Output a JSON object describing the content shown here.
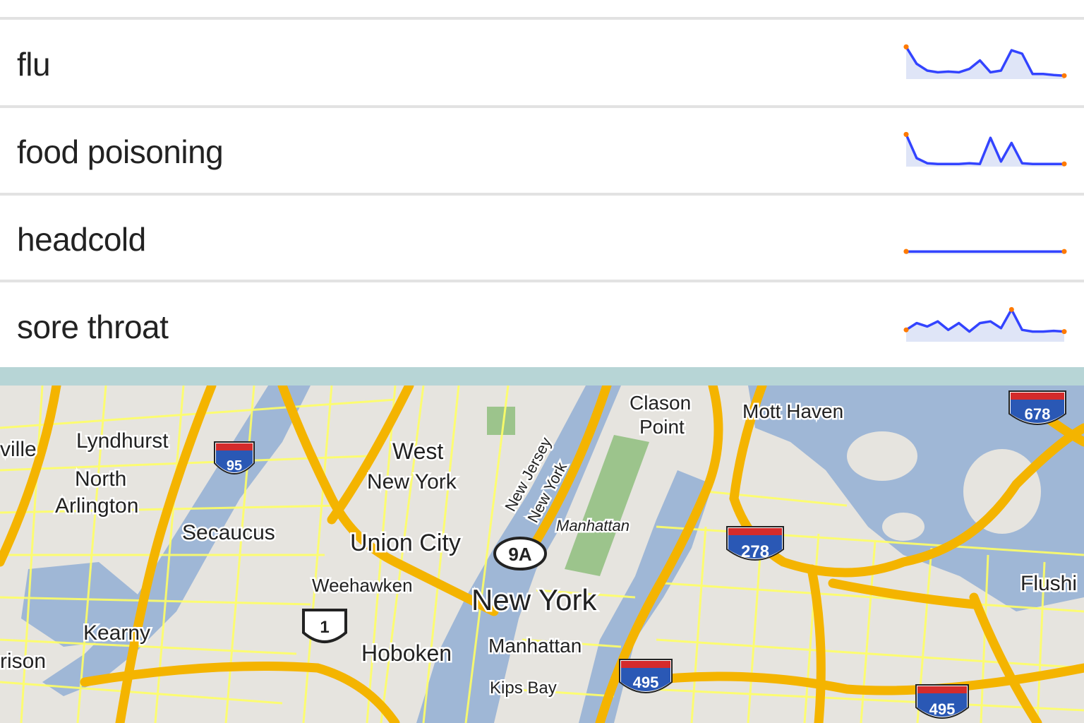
{
  "results": {
    "items": [
      {
        "term": "flu",
        "trend": [
          0.95,
          0.45,
          0.25,
          0.2,
          0.22,
          0.2,
          0.3,
          0.55,
          0.2,
          0.25,
          0.85,
          0.75,
          0.15,
          0.15,
          0.12,
          0.1
        ]
      },
      {
        "term": "food poisoning",
        "trend": [
          0.95,
          0.25,
          0.1,
          0.08,
          0.08,
          0.08,
          0.1,
          0.08,
          0.85,
          0.15,
          0.7,
          0.1,
          0.08,
          0.08,
          0.08,
          0.08
        ]
      },
      {
        "term": "headcold",
        "trend": [
          0.08,
          0.08,
          0.08,
          0.08,
          0.08,
          0.08,
          0.08,
          0.08,
          0.08,
          0.08,
          0.08,
          0.08,
          0.08,
          0.08,
          0.08,
          0.08
        ]
      },
      {
        "term": "sore throat",
        "trend": [
          0.35,
          0.55,
          0.45,
          0.6,
          0.35,
          0.55,
          0.3,
          0.55,
          0.6,
          0.4,
          0.95,
          0.35,
          0.3,
          0.3,
          0.32,
          0.3
        ]
      }
    ]
  },
  "colors": {
    "sparkline": "#3344ff",
    "sparkline_fill": "#c9d3f2",
    "endpoint": "#ff7a00",
    "water": "#9fb7d6",
    "land": "#e6e4df",
    "highway": "#f4b400",
    "street": "#ffff66",
    "park": "#9cc48c",
    "shield_red": "#d42b2b",
    "shield_blue": "#2a58b5"
  },
  "map": {
    "labels": [
      "Lyndhurst",
      "North",
      "Arlington",
      "Secaucus",
      "Kearny",
      "rison",
      "West",
      "New York",
      "Union City",
      "Weehawken",
      "Hoboken",
      "New York",
      "Manhattan",
      "Manhattan",
      "Kips Bay",
      "New Jersey",
      "New York",
      "Clason",
      "Point",
      "Mott Haven",
      "Flushi",
      "ville"
    ],
    "shields": [
      "95",
      "278",
      "495",
      "495",
      "678",
      "9A",
      "1"
    ]
  }
}
